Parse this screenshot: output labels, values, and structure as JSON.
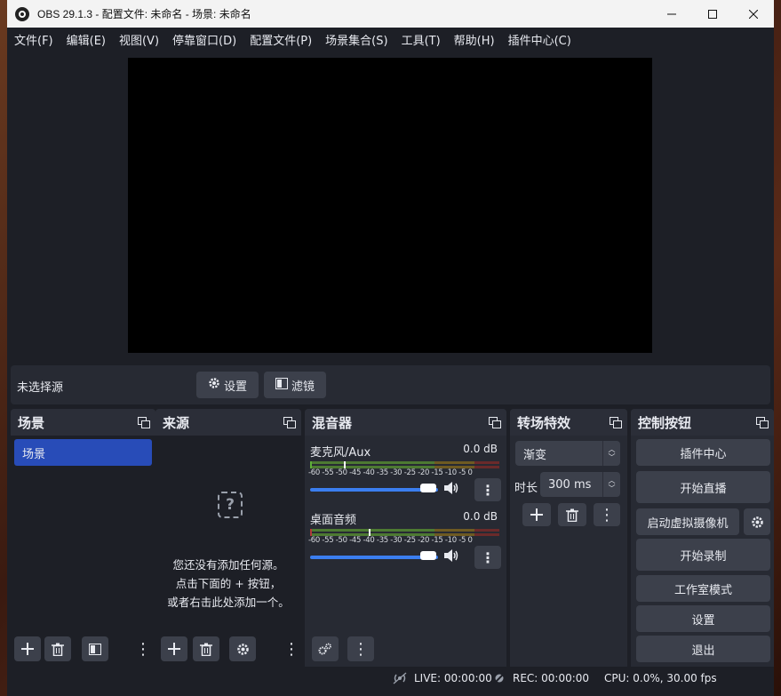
{
  "window": {
    "title": "OBS 29.1.3 - 配置文件: 未命名 - 场景: 未命名",
    "controls": [
      "minimize-icon",
      "maximize-icon",
      "close-icon"
    ]
  },
  "menu": [
    "文件(F)",
    "编辑(E)",
    "视图(V)",
    "停靠窗口(D)",
    "配置文件(P)",
    "场景集合(S)",
    "工具(T)",
    "帮助(H)",
    "插件中心(C)"
  ],
  "source_toolbar": {
    "no_selection": "未选择源",
    "properties_label": "设置",
    "filters_label": "滤镜"
  },
  "scenes": {
    "title": "场景",
    "items": [
      "场景"
    ]
  },
  "sources": {
    "title": "来源",
    "empty_line1": "您还没有添加任何源。",
    "empty_line2": "点击下面的 + 按钮，",
    "empty_line3": "或者右击此处添加一个。"
  },
  "mixer": {
    "title": "混音器",
    "scale": "-60 -55 -50 -45 -40 -35 -30 -25 -20 -15 -10  -5   0",
    "channels": [
      {
        "name": "麦克风/Aux",
        "db": "0.0 dB",
        "volume": 1.0
      },
      {
        "name": "桌面音频",
        "db": "0.0 dB",
        "volume": 1.0
      }
    ]
  },
  "transitions": {
    "title": "转场特效",
    "selected": "渐变",
    "duration_label": "时长",
    "duration_value": "300 ms"
  },
  "controls": {
    "title": "控制按钮",
    "buttons": [
      "插件中心",
      "开始直播",
      "启动虚拟摄像机",
      "开始录制",
      "工作室模式",
      "设置",
      "退出"
    ]
  },
  "status": {
    "live": "LIVE: 00:00:00",
    "rec": "REC: 00:00:00",
    "cpu": "CPU: 0.0%, 30.00 fps"
  },
  "colors": {
    "accent": "#284cb8",
    "background": "#1d1f26",
    "panel": "#272a33",
    "button": "#3c404b",
    "slider": "#3b7ef0",
    "meter_green": "#5fb03a",
    "meter_yellow": "#c9a227",
    "meter_red": "#b03a3a"
  }
}
